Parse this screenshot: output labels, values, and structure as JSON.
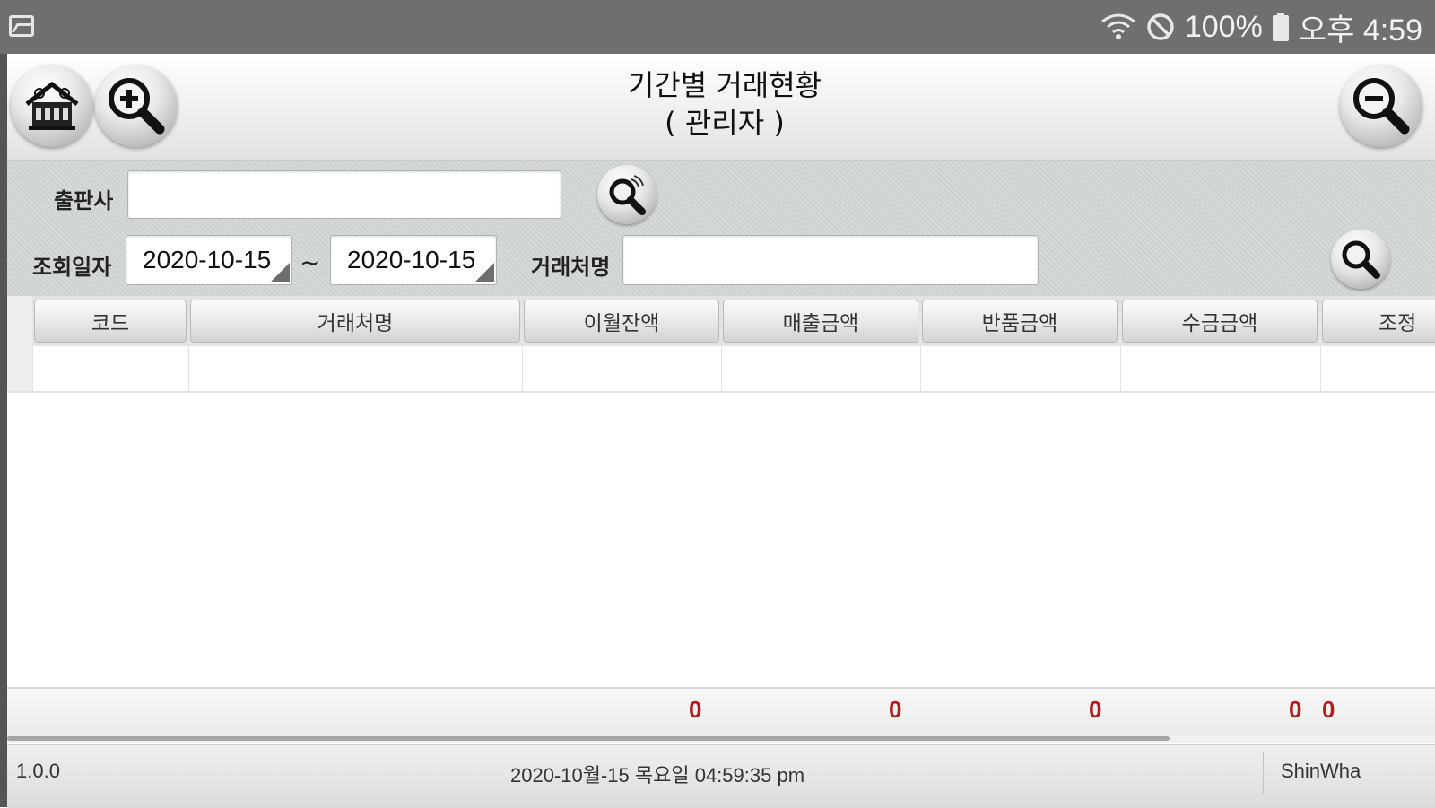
{
  "status_bar": {
    "battery": "100%",
    "time": "오후 4:59",
    "icons": [
      "gallery-icon",
      "wifi-icon",
      "do-not-disturb-icon",
      "battery-icon"
    ]
  },
  "header": {
    "title_line1": "기간별 거래현황",
    "title_line2": "( 관리자 )",
    "buttons": [
      "home-icon",
      "zoom-in-icon",
      "zoom-out-icon"
    ]
  },
  "search": {
    "publisher_label": "출판사",
    "publisher_value": "",
    "date_label": "조회일자",
    "date_from": "2020-10-15",
    "date_separator": "~",
    "date_to": "2020-10-15",
    "client_label": "거래처명",
    "client_value": ""
  },
  "grid": {
    "columns": [
      "코드",
      "거래처명",
      "이월잔액",
      "매출금액",
      "반품금액",
      "수금금액",
      "조정"
    ],
    "rows": [
      [
        "",
        "",
        "",
        "",
        "",
        "",
        ""
      ]
    ]
  },
  "totals": {
    "carryover": "0",
    "sales": "0",
    "returns": "0",
    "collections": "0",
    "adjustment": "0"
  },
  "footer": {
    "version": "1.0.0",
    "datetime": "2020-10월-15 목요일 04:59:35 pm",
    "company": "ShinWha"
  }
}
